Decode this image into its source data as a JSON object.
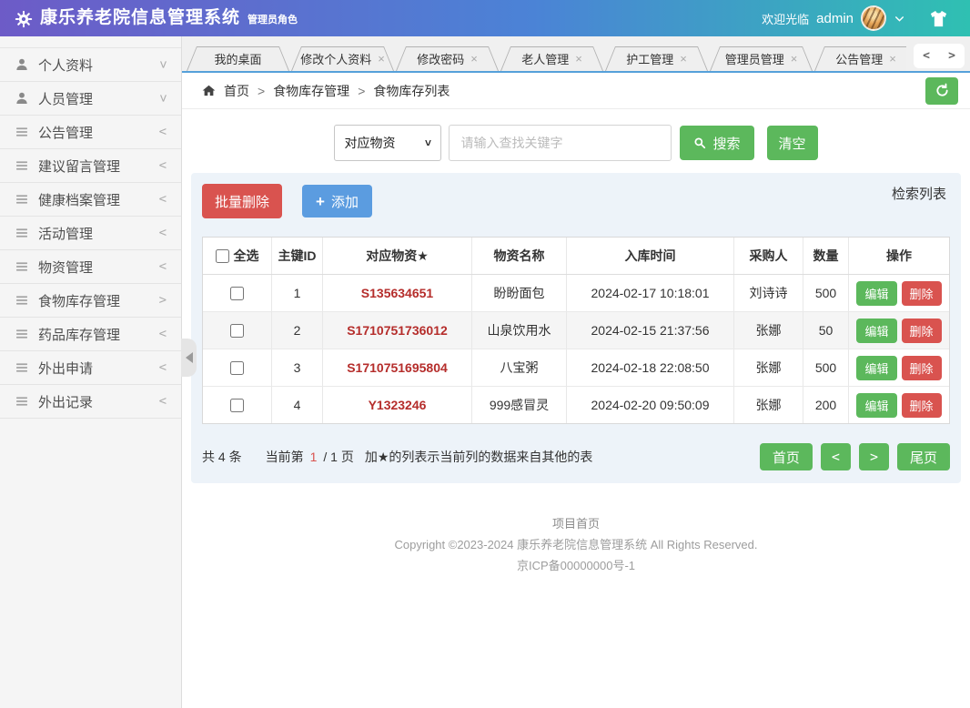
{
  "header": {
    "title": "康乐养老院信息管理系统",
    "subtitle": "管理员角色",
    "welcome": "欢迎光临",
    "username": "admin"
  },
  "tabs": {
    "prev": "<",
    "next": ">",
    "items": [
      {
        "label": "我的桌面",
        "closable": false
      },
      {
        "label": "修改个人资料",
        "closable": true
      },
      {
        "label": "修改密码",
        "closable": true
      },
      {
        "label": "老人管理",
        "closable": true
      },
      {
        "label": "护工管理",
        "closable": true
      },
      {
        "label": "管理员管理",
        "closable": true
      },
      {
        "label": "公告管理",
        "closable": true
      }
    ]
  },
  "sidebar": {
    "items": [
      {
        "label": "个人资料",
        "icon": "user",
        "chevron": "down"
      },
      {
        "label": "人员管理",
        "icon": "user",
        "chevron": "down"
      },
      {
        "label": "公告管理",
        "icon": "list",
        "chevron": "left"
      },
      {
        "label": "建议留言管理",
        "icon": "list",
        "chevron": "left"
      },
      {
        "label": "健康档案管理",
        "icon": "list",
        "chevron": "left"
      },
      {
        "label": "活动管理",
        "icon": "list",
        "chevron": "left"
      },
      {
        "label": "物资管理",
        "icon": "list",
        "chevron": "left"
      },
      {
        "label": "食物库存管理",
        "icon": "list",
        "chevron": "right"
      },
      {
        "label": "药品库存管理",
        "icon": "list",
        "chevron": "left"
      },
      {
        "label": "外出申请",
        "icon": "list",
        "chevron": "left"
      },
      {
        "label": "外出记录",
        "icon": "list",
        "chevron": "left"
      }
    ]
  },
  "breadcrumb": {
    "home": "首页",
    "level1": "食物库存管理",
    "level2": "食物库存列表",
    "separator": ">"
  },
  "search": {
    "filter_value": "对应物资",
    "placeholder": "请输入查找关键字",
    "search_label": "搜索",
    "clear_label": "清空"
  },
  "toolbar": {
    "batch_delete_label": "批量删除",
    "add_label": "添加",
    "panel_title": "检索列表"
  },
  "table": {
    "headers": [
      "全选",
      "主键ID",
      "对应物资★",
      "物资名称",
      "入库时间",
      "采购人",
      "数量",
      "操作"
    ],
    "edit_label": "编辑",
    "delete_label": "删除",
    "rows": [
      {
        "id": "1",
        "code": "S135634651",
        "name": "盼盼面包",
        "time": "2024-02-17 10:18:01",
        "buyer": "刘诗诗",
        "qty": "500"
      },
      {
        "id": "2",
        "code": "S1710751736012",
        "name": "山泉饮用水",
        "time": "2024-02-15 21:37:56",
        "buyer": "张娜",
        "qty": "50"
      },
      {
        "id": "3",
        "code": "S1710751695804",
        "name": "八宝粥",
        "time": "2024-02-18 22:08:50",
        "buyer": "张娜",
        "qty": "500"
      },
      {
        "id": "4",
        "code": "Y1323246",
        "name": "999感冒灵",
        "time": "2024-02-20 09:50:09",
        "buyer": "张娜",
        "qty": "200"
      }
    ]
  },
  "pagination": {
    "total_text": "共 4 条",
    "current_prefix": "当前第",
    "current_page": "1",
    "current_suffix": "/ 1 页",
    "note": "加★的列表示当前列的数据来自其他的表",
    "first_label": "首页",
    "prev_label": "<",
    "next_label": ">",
    "last_label": "尾页"
  },
  "footer": {
    "line1": "项目首页",
    "line2": "Copyright ©2023-2024 康乐养老院信息管理系统 All Rights Reserved.",
    "line3": "京ICP备00000000号-1"
  },
  "colors": {
    "header_gradient_start": "#6d5bc7",
    "header_gradient_mid": "#4b83d6",
    "header_gradient_end": "#2fc0b2",
    "green": "#5cb85c",
    "red": "#d9534f",
    "blue": "#5b9ce0",
    "code_text": "#b52d2b",
    "tabbar_line": "#55a0da"
  }
}
